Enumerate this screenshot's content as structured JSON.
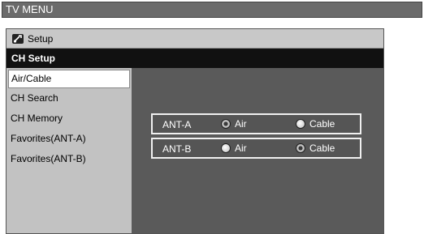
{
  "title": "TV MENU",
  "setup": {
    "label": "Setup",
    "icon": "wrench-icon"
  },
  "section": "CH Setup",
  "sidebar": {
    "items": [
      {
        "label": "Air/Cable"
      },
      {
        "label": "CH Search"
      },
      {
        "label": "CH Memory"
      },
      {
        "label": "Favorites(ANT-A)"
      },
      {
        "label": "Favorites(ANT-B)"
      }
    ]
  },
  "rows": [
    {
      "label": "ANT-A",
      "opt1": "Air",
      "opt2": "Cable",
      "selected": "Air"
    },
    {
      "label": "ANT-B",
      "opt1": "Air",
      "opt2": "Cable",
      "selected": "Cable"
    }
  ]
}
